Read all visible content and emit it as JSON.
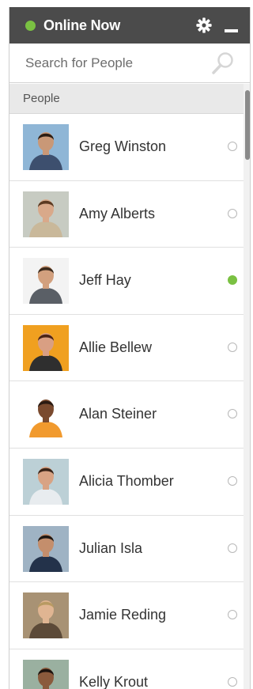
{
  "header": {
    "status_label": "Online Now",
    "status_color": "#7ac142",
    "settings_icon": "gear-icon",
    "minimize_icon": "minimize-icon"
  },
  "search": {
    "placeholder": "Search for People",
    "icon": "search-icon"
  },
  "section": {
    "title": "People"
  },
  "people": [
    {
      "name": "Greg Winston",
      "online": false,
      "avatar_bg": "#8fb6d6",
      "shirt": "#3d4f6e",
      "skin": "#c99877",
      "hair": "#2b1d14"
    },
    {
      "name": "Amy Alberts",
      "online": false,
      "avatar_bg": "#c7cbc2",
      "shirt": "#c9b89a",
      "skin": "#d9a98a",
      "hair": "#5b3a22"
    },
    {
      "name": "Jeff Hay",
      "online": true,
      "avatar_bg": "#f3f3f3",
      "shirt": "#5a5f66",
      "skin": "#d2a07e",
      "hair": "#3b2a1c"
    },
    {
      "name": "Allie Bellew",
      "online": false,
      "avatar_bg": "#f0a020",
      "shirt": "#2f2f2f",
      "skin": "#d99f83",
      "hair": "#4a2416"
    },
    {
      "name": "Alan Steiner",
      "online": false,
      "avatar_bg": "#ffffff",
      "shirt": "#f19a2e",
      "skin": "#7a4a2e",
      "hair": "#2a1a12"
    },
    {
      "name": "Alicia Thomber",
      "online": false,
      "avatar_bg": "#bcd0d6",
      "shirt": "#e8ecef",
      "skin": "#d8a384",
      "hair": "#3a2418"
    },
    {
      "name": "Julian Isla",
      "online": false,
      "avatar_bg": "#9fb3c4",
      "shirt": "#23324a",
      "skin": "#c48e6c",
      "hair": "#1f1712"
    },
    {
      "name": "Jamie Reding",
      "online": false,
      "avatar_bg": "#a89274",
      "shirt": "#5c4a38",
      "skin": "#e0b592",
      "hair": "#b89a62"
    },
    {
      "name": "Kelly Krout",
      "online": false,
      "avatar_bg": "#9ab0a0",
      "shirt": "#7a3e5a",
      "skin": "#8a5a3c",
      "hair": "#1c130e"
    }
  ]
}
